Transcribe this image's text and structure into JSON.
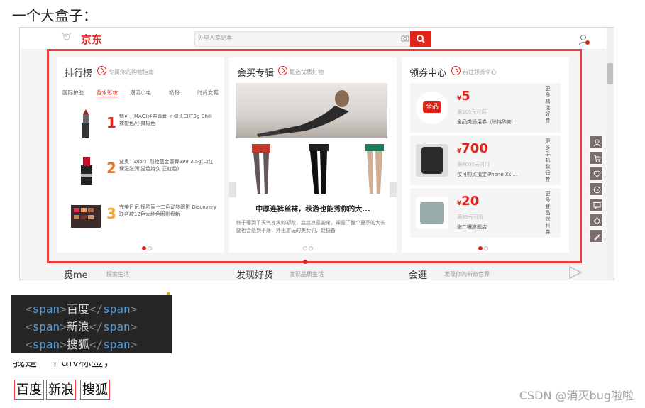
{
  "heading": "一个大盒子：",
  "screenshot": {
    "logo": "京东",
    "search_placeholder": "外星人笔记本",
    "panels": {
      "rank": {
        "title": "排行榜",
        "subtitle": "专属你的购物指南",
        "tabs": [
          "国际护肤",
          "香水彩妆",
          "潮流小电",
          "奶粉",
          "时尚女鞋"
        ],
        "active_tab": 1,
        "items": [
          {
            "rank": "1",
            "text": "魅可（MAC)经典唇膏 子弹头口红3g Chili 辣椒色/小辣椒色",
            "color": "#e1251b"
          },
          {
            "rank": "2",
            "text": "迪奥（Dior）烈艳蓝金唇膏999 3.5g(口红 保湿滋润 显色持久 正红色)",
            "color": "#f0731d"
          },
          {
            "rank": "3",
            "text": "完美日记 探险家十二色动物眼影 Discovery联名款12色大地色眼影盘新",
            "color": "#f5a623"
          }
        ]
      },
      "special": {
        "title": "会买专辑",
        "subtitle": "甄选优质好物",
        "caption": "中厚连裤丝袜，秋游也能秀你的大...",
        "desc": "终于等到了天气凉爽的初秋，丝丝凉意袭来，裸露了整个夏季的大长腿也会感到不适，外出游玩的美女们，赶快备"
      },
      "coupon": {
        "title": "领券中心",
        "subtitle": "前往领券中心",
        "items": [
          {
            "price": "5",
            "cond": "满105元可用",
            "name": "全品类通用券（除特殊商...",
            "side": "更多精选好券",
            "badge": "全品类"
          },
          {
            "price": "700",
            "cond": "满8000元可用",
            "name": "仅可购买指定iPhone Xs ...",
            "side": "更多手机数码券"
          },
          {
            "price": "20",
            "cond": "满99元可用",
            "name": "张二嘎旗舰店",
            "side": "更多食品饮料券"
          }
        ]
      }
    },
    "bottom_titles": [
      "觅me",
      "发现好货",
      "会逛"
    ],
    "bottom_subs": [
      "探索生活",
      "发现品质生活",
      "发现你的新奇世界"
    ]
  },
  "code": {
    "lines": [
      "百度",
      "新浪",
      "搜狐"
    ],
    "tag": "span"
  },
  "partial_text": "我是一个div标签，",
  "span_demo": [
    "百度",
    "新浪",
    "搜狐"
  ],
  "watermark": "CSDN @消灭bug啦啦",
  "colors": {
    "jd_red": "#e1251b",
    "box_red": "#f03c3c",
    "code_bg": "#252526",
    "code_tag": "#569cd6"
  }
}
